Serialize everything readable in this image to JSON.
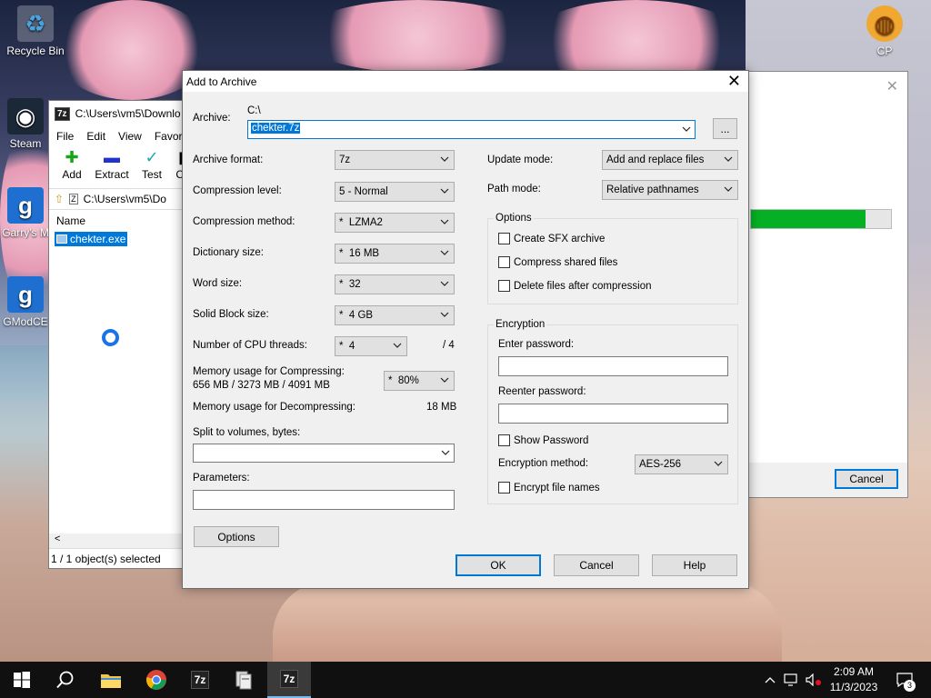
{
  "desktop": {
    "icons": [
      {
        "label": "Recycle Bin"
      },
      {
        "label": "Steam"
      },
      {
        "label": "Garry's M"
      },
      {
        "label": "GModCE"
      },
      {
        "label": "CP"
      }
    ]
  },
  "filemanager": {
    "title": "C:\\Users\\vm5\\Downlo",
    "menu": [
      "File",
      "Edit",
      "View",
      "Favorit"
    ],
    "tools": [
      "Add",
      "Extract",
      "Test",
      "Co"
    ],
    "address": "C:\\Users\\vm5\\Do",
    "column_name": "Name",
    "file": "chekter.exe",
    "scroll_left": "<",
    "status": "1 / 1 object(s) selected"
  },
  "progress_window": {
    "close": "✕",
    "progress": 0.82,
    "cancel": "Cancel"
  },
  "dialog": {
    "title": "Add to Archive",
    "close": "✕",
    "archive_label": "Archive:",
    "archive_path": "C:\\",
    "archive_name": "chekter.7z",
    "browse": "...",
    "format_label": "Archive format:",
    "format_value": "7z",
    "level_label": "Compression level:",
    "level_value": "5 - Normal",
    "method_label": "Compression method:",
    "method_value": "*  LZMA2",
    "dict_label": "Dictionary size:",
    "dict_value": "*  16 MB",
    "word_label": "Word size:",
    "word_value": "*  32",
    "solid_label": "Solid Block size:",
    "solid_value": "*  4 GB",
    "threads_label": "Number of CPU threads:",
    "threads_value": "*  4",
    "threads_total": "/ 4",
    "mem_comp_label": "Memory usage for Compressing:",
    "mem_comp_value": "656 MB / 3273 MB / 4091 MB",
    "mem_percent": "*  80%",
    "mem_decomp_label": "Memory usage for Decompressing:",
    "mem_decomp_value": "18 MB",
    "split_label": "Split to volumes, bytes:",
    "split_value": "",
    "params_label": "Parameters:",
    "params_value": "",
    "options_button": "Options",
    "update_label": "Update mode:",
    "update_value": "Add and replace files",
    "pathmode_label": "Path mode:",
    "pathmode_value": "Relative pathnames",
    "options_group": "Options",
    "opt_sfx": "Create SFX archive",
    "opt_shared": "Compress shared files",
    "opt_delete": "Delete files after compression",
    "enc_group": "Encryption",
    "enter_pw": "Enter password:",
    "reenter_pw": "Reenter password:",
    "show_pw": "Show Password",
    "enc_method_label": "Encryption method:",
    "enc_method_value": "AES-256",
    "encrypt_names": "Encrypt file names",
    "ok": "OK",
    "cancel": "Cancel",
    "help": "Help"
  },
  "taskbar": {
    "apps": [
      "start-icon",
      "search-icon",
      "file-explorer-icon",
      "chrome-icon",
      "7zip-icon",
      "archive-icon",
      "7zip-active-icon"
    ],
    "badge_7z": "7z",
    "time": "2:09 AM",
    "date": "11/3/2023",
    "notifications": "3"
  }
}
